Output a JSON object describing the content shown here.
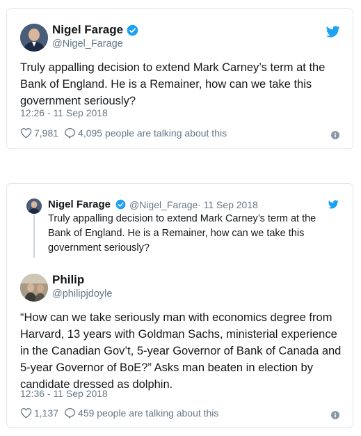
{
  "tweet1": {
    "name": "Nigel Farage",
    "handle": "@Nigel_Farage",
    "text": "Truly appalling decision to extend Mark Carney’s term at the Bank of England. He is a Remainer, how can we take this government seriously?",
    "timestamp": "12:26 - 11 Sep 2018",
    "likes": "7,981",
    "talking": "4,095 people are talking about this"
  },
  "tweet2": {
    "quoted": {
      "name": "Nigel Farage",
      "handle": "@Nigel_Farage",
      "date": "· 11 Sep 2018",
      "text": "Truly appalling decision to extend Mark Carney’s term at the Bank of England. He is a Remainer, how can we take this government seriously?"
    },
    "name": "Philip",
    "handle": "@philipjdoyle",
    "text": "“How can we take seriously man with economics degree from Harvard, 13 years with Goldman Sachs, ministerial experience in the Canadian Gov’t, 5-year Governor of Bank of Canada and 5-year Governor of BoE?” Asks man beaten in election by candidate dressed as dolphin.",
    "timestamp": "12:36 - 11 Sep 2018",
    "likes": "1,137",
    "talking": "459 people are talking about this"
  },
  "colors": {
    "twitter_blue": "#1da1f2",
    "secondary_text": "#657786",
    "border": "#e1e8ed"
  },
  "icons": [
    "twitter-bird-icon",
    "verified-badge-icon",
    "heart-icon",
    "reply-bubble-icon",
    "info-icon"
  ]
}
